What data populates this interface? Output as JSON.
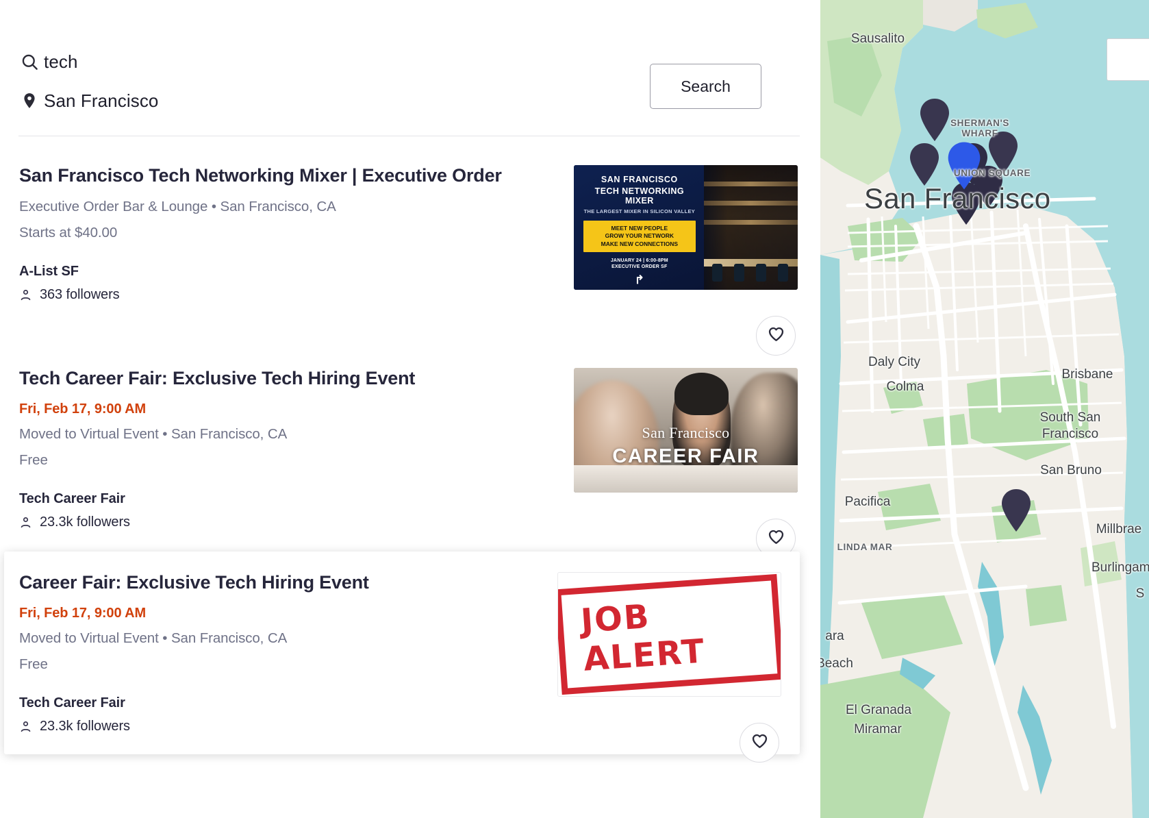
{
  "search": {
    "query": "tech",
    "location": "San Francisco",
    "search_button": "Search",
    "search_icon": "search-icon",
    "location_icon": "map-pin-icon"
  },
  "events": [
    {
      "title": "San Francisco Tech Networking Mixer | Executive Order",
      "date": "",
      "venue": "Executive Order Bar & Lounge • San Francisco, CA",
      "price": "Starts at $40.00",
      "organizer": "A-List SF",
      "followers": "363 followers",
      "thumbnail": {
        "kind": "mixer-poster",
        "line1": "SAN FRANCISCO",
        "line2": "TECH NETWORKING MIXER",
        "line3": "THE LARGEST MIXER IN SILICON VALLEY",
        "box1": "MEET NEW PEOPLE",
        "box2": "GROW YOUR NETWORK",
        "box3": "MAKE NEW CONNECTIONS",
        "line4": "JANUARY 24 | 6:00-8PM",
        "line5": "EXECUTIVE ORDER SF",
        "logo": "↱"
      }
    },
    {
      "title": "Tech Career Fair: Exclusive Tech Hiring Event",
      "date": "Fri, Feb 17, 9:00 AM",
      "venue": "Moved to Virtual Event • San Francisco, CA",
      "price": "Free",
      "organizer": "Tech Career Fair",
      "followers": "23.3k followers",
      "thumbnail": {
        "kind": "career-photo",
        "line1": "San Francisco",
        "line2": "CAREER FAIR"
      }
    },
    {
      "title": "Career Fair: Exclusive Tech Hiring Event",
      "date": "Fri, Feb 17, 9:00 AM",
      "venue": "Moved to Virtual Event • San Francisco, CA",
      "price": "Free",
      "organizer": "Tech Career Fair",
      "followers": "23.3k followers",
      "thumbnail": {
        "kind": "job-alert-stamp",
        "line1": "JOB ALERT"
      }
    }
  ],
  "map": {
    "labels": [
      "Sausalito",
      "SHERMAN'S\nWHARF",
      "UNION SQUARE",
      "San Francisco",
      "Daly City",
      "Colma",
      "Brisbane",
      "South San\nFrancisco",
      "San Bruno",
      "Pacifica",
      "LINDA MAR",
      "Millbrae",
      "Burlingame",
      "El Granada",
      "Miramar",
      "ara",
      "Beach",
      "S"
    ],
    "pin_count": 8,
    "selected_pin_color": "#2d59e8",
    "pin_color": "#39364f"
  },
  "colors": {
    "text_primary": "#26263b",
    "text_muted": "#6f7287",
    "date_accent": "#d1410c",
    "map_water": "#aadcdf",
    "map_land": "#f2efe9",
    "map_park": "#b8ddae"
  }
}
